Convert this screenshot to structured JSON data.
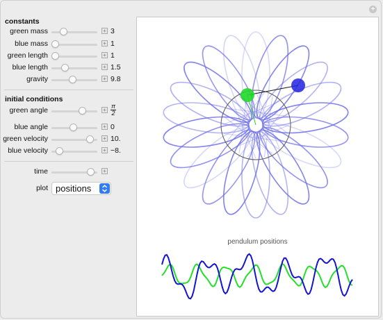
{
  "constants": {
    "title": "constants",
    "rows": [
      {
        "label": "green mass",
        "value": "3",
        "knob": 0.22
      },
      {
        "label": "blue mass",
        "value": "1",
        "knob": 0.0
      },
      {
        "label": "green length",
        "value": "1",
        "knob": 0.0
      },
      {
        "label": "blue length",
        "value": "1.5",
        "knob": 0.25
      },
      {
        "label": "gravity",
        "value": "9.8",
        "knob": 0.45
      }
    ]
  },
  "initial_conditions": {
    "title": "initial conditions",
    "green_angle": {
      "label": "green angle",
      "numerator": "π",
      "denominator": "2",
      "knob": 0.7
    },
    "blue_angle": {
      "label": "blue angle",
      "value": "0",
      "knob": 0.48
    },
    "green_velocity": {
      "label": "green velocity",
      "value": "10.",
      "knob": 0.9
    },
    "blue_velocity": {
      "label": "blue velocity",
      "value": "−8.",
      "knob": 0.1
    }
  },
  "time": {
    "label": "time",
    "knob": 0.93
  },
  "plot": {
    "label": "plot",
    "selected": "positions"
  },
  "graph": {
    "caption": "pendulum positions"
  },
  "colors": {
    "green": "#22e02a",
    "blue": "#1414e0",
    "trace": "#6b6bea"
  },
  "icons": {
    "corner": "plus-icon",
    "stepper": "plus-icon",
    "select": "chevron-updown-icon"
  }
}
